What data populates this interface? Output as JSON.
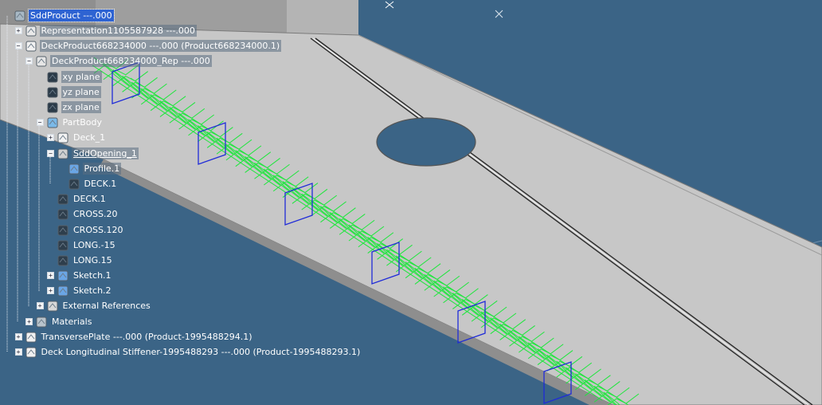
{
  "tree": {
    "root": "SddProduct ---.000",
    "items": [
      {
        "label": "Representation1105587928 ---.000",
        "icon": "representation-icon"
      },
      {
        "label": "DeckProduct668234000 ---.000 (Product668234000.1)",
        "icon": "product-icon"
      },
      {
        "label": "DeckProduct668234000_Rep ---.000",
        "icon": "part-rep-icon"
      },
      {
        "label": "xy plane",
        "icon": "plane-icon"
      },
      {
        "label": "yz plane",
        "icon": "plane-icon"
      },
      {
        "label": "zx plane",
        "icon": "plane-icon"
      },
      {
        "label": "PartBody",
        "icon": "partbody-icon"
      },
      {
        "label": "Deck_1",
        "icon": "deck-icon"
      },
      {
        "label": "SddOpening_1",
        "icon": "opening-icon"
      },
      {
        "label": "Profile.1",
        "icon": "profile-icon"
      },
      {
        "label": "DECK.1",
        "icon": "surface-icon"
      },
      {
        "label": "DECK.1",
        "icon": "surface-icon"
      },
      {
        "label": "CROSS.20",
        "icon": "surface-icon"
      },
      {
        "label": "CROSS.120",
        "icon": "surface-icon"
      },
      {
        "label": "LONG.-15",
        "icon": "surface-icon"
      },
      {
        "label": "LONG.15",
        "icon": "surface-icon"
      },
      {
        "label": "Sketch.1",
        "icon": "sketch-icon"
      },
      {
        "label": "Sketch.2",
        "icon": "sketch-icon"
      },
      {
        "label": "External References",
        "icon": "external-references-icon"
      },
      {
        "label": "Materials",
        "icon": "materials-icon"
      },
      {
        "label": "TransversePlate ---.000 (Product-1995488294.1)",
        "icon": "product-icon"
      },
      {
        "label": "Deck Longitudinal Stiffener-1995488293 ---.000 (Product-1995488293.1)",
        "icon": "product-icon"
      }
    ]
  },
  "colors": {
    "background": "#3b6486",
    "plate": "#c7c7c7",
    "plate_edge": "#8e8e8e",
    "stiffener_pattern": "#1ee63c",
    "opening_outline": "#1f2bd8",
    "selection": "#2e63d2"
  }
}
